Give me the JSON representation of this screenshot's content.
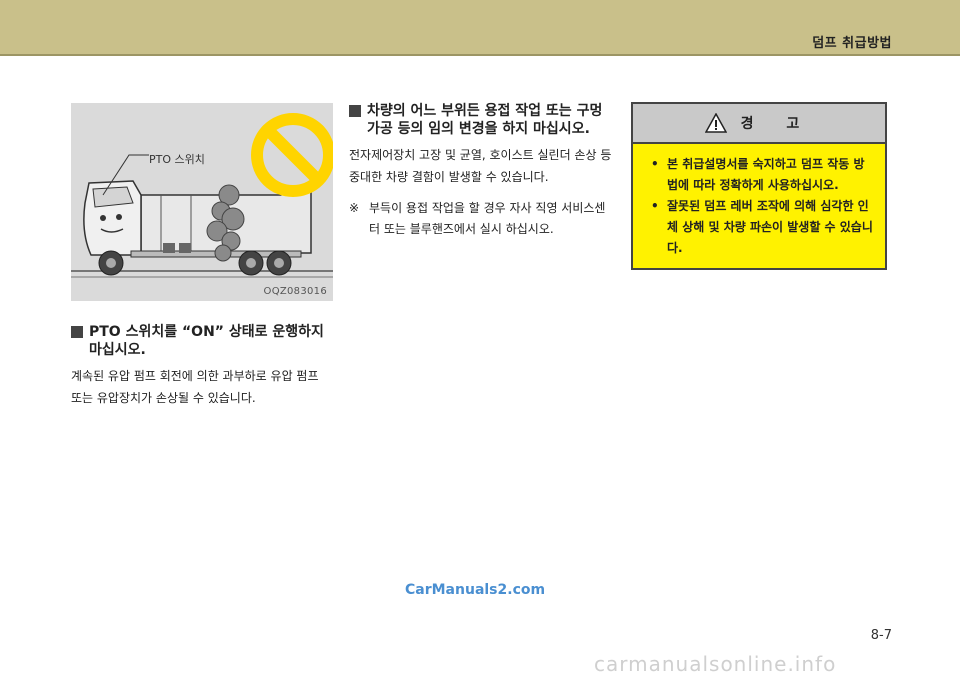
{
  "header": {
    "chapter_title": "덤프 취급방법"
  },
  "illustration": {
    "pto_label": "PTO 스위치",
    "figure_code": "OQZ083016",
    "prohibition_color": "#ffd400",
    "icon": "prohibition-icon"
  },
  "section_pto": {
    "heading": "PTO 스위치를 “ON” 상태로 운행하지 마십시오.",
    "body": "계속된 유압 펌프 회전에 의한 과부하로 유압 펌프 또는 유압장치가 손상될 수 있습니다."
  },
  "section_welding": {
    "heading": "차량의 어느 부위든 용접 작업 또는 구멍 가공 등의 임의 변경을 하지 마십시오.",
    "body": "전자제어장치 고장 및 균열, 호이스트 실린더 손상 등 중대한 차량 결함이 발생할 수 있습니다.",
    "note_mark": "※",
    "note": "부득이 용접 작업을 할 경우 자사 직영 서비스센터 또는 블루핸즈에서 실시 하십시오."
  },
  "warning": {
    "title": "경 고",
    "bullet": "•",
    "items": [
      "본 취급설명서를 숙지하고 덤프 작동 방법에 따라 정확하게 사용하십시오.",
      "잘못된 덤프 레버 조작에 의해 심각한 인체 상해 및 차량 파손이 발생할 수 있습니다."
    ],
    "background_color": "#fff200"
  },
  "watermark": "CarManuals2.com",
  "footer_site": "carmanualsonline.info",
  "page_number": "8-7"
}
